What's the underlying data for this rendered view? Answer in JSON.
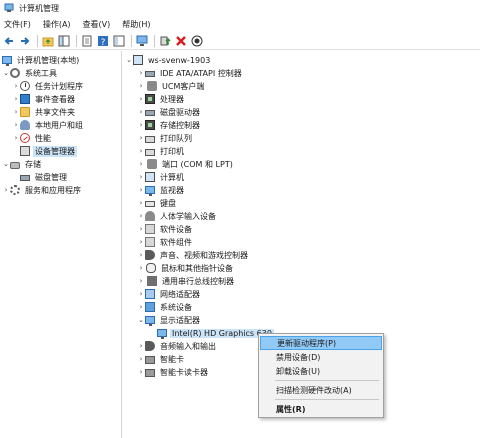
{
  "window": {
    "title": "计算机管理"
  },
  "menu": [
    "文件(F)",
    "操作(A)",
    "查看(V)",
    "帮助(H)"
  ],
  "toolbar": [
    "back-icon",
    "forward-icon",
    "up-folder-icon",
    "show-tree-icon",
    "properties-icon",
    "help-icon",
    "panel-icon",
    "monitor-icon",
    "update-driver-icon",
    "uninstall-icon",
    "disable-icon"
  ],
  "left_tree": {
    "root": "计算机管理(本地)",
    "system_tools": "系统工具",
    "task_scheduler": "任务计划程序",
    "event_viewer": "事件查看器",
    "shared_folders": "共享文件夹",
    "local_users": "本地用户和组",
    "performance": "性能",
    "device_manager": "设备管理器",
    "storage": "存储",
    "disk_management": "磁盘管理",
    "services": "服务和应用程序"
  },
  "device_tree": {
    "computer_name": "ws-svenw-1903",
    "categories": [
      "IDE ATA/ATAPI 控制器",
      "UCM客户端",
      "处理器",
      "磁盘驱动器",
      "存储控制器",
      "打印队列",
      "打印机",
      "端口 (COM 和 LPT)",
      "计算机",
      "监视器",
      "键盘",
      "人体学输入设备",
      "软件设备",
      "软件组件",
      "声音、视频和游戏控制器",
      "鼠标和其他指针设备",
      "通用串行总线控制器",
      "网络适配器",
      "系统设备",
      "显示适配器"
    ],
    "display_child": "Intel(R) HD Graphics 630",
    "after": [
      "音频输入和输出",
      "智能卡",
      "智能卡读卡器"
    ]
  },
  "context_menu": {
    "update_driver": "更新驱动程序(P)",
    "disable_device": "禁用设备(D)",
    "uninstall_device": "卸载设备(U)",
    "scan_hardware": "扫描检测硬件改动(A)",
    "properties": "属性(R)"
  }
}
